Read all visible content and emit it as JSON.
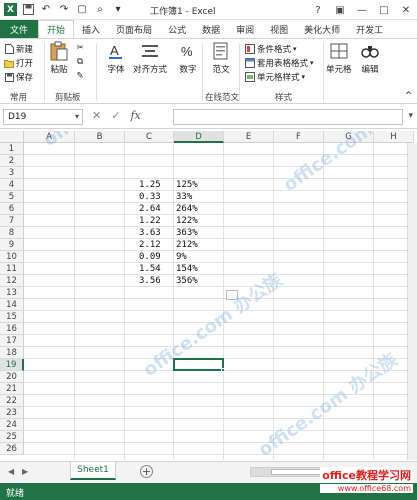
{
  "window": {
    "title": "工作簿1 - Excel",
    "minimize": "—",
    "restore": "□",
    "close": "✕",
    "help": "?",
    "ribbon_display": "▣"
  },
  "tabs": [
    {
      "label": "文件"
    },
    {
      "label": "开始"
    },
    {
      "label": "插入"
    },
    {
      "label": "页面布局"
    },
    {
      "label": "公式"
    },
    {
      "label": "数据"
    },
    {
      "label": "审阅"
    },
    {
      "label": "视图"
    },
    {
      "label": "美化大师"
    },
    {
      "label": "开发工"
    }
  ],
  "ribbon": {
    "quick_new": "新建",
    "quick_open": "打开",
    "quick_save": "保存",
    "group_common": "常用",
    "paste": "粘贴",
    "group_clipboard": "剪贴板",
    "font": "字体",
    "alignment": "对齐方式",
    "number": "数字",
    "fanwen": "范文",
    "group_fanwen": "在线范文",
    "conditional_format": "条件格式",
    "table_format": "套用表格格式",
    "cell_style": "单元格样式",
    "group_style": "样式",
    "cells": "单元格",
    "editing": "编辑"
  },
  "formula_bar": {
    "name_box": "D19",
    "cancel": "✕",
    "enter": "✓",
    "fx": "fx",
    "value": ""
  },
  "grid": {
    "columns": [
      "A",
      "B",
      "C",
      "D",
      "E",
      "F",
      "G",
      "H"
    ],
    "rows": [
      "1",
      "2",
      "3",
      "4",
      "5",
      "6",
      "7",
      "8",
      "9",
      "10",
      "11",
      "12",
      "13",
      "14",
      "15",
      "16",
      "17",
      "18",
      "19",
      "20",
      "21",
      "22",
      "23",
      "24",
      "25",
      "26"
    ],
    "selected_cell": "D19",
    "data_rows": [
      {
        "row": "4",
        "c": "1.25",
        "d": "125%"
      },
      {
        "row": "5",
        "c": "0.33",
        "d": "33%"
      },
      {
        "row": "6",
        "c": "2.64",
        "d": "264%"
      },
      {
        "row": "7",
        "c": "1.22",
        "d": "122%"
      },
      {
        "row": "8",
        "c": "3.63",
        "d": "363%"
      },
      {
        "row": "9",
        "c": "2.12",
        "d": "212%"
      },
      {
        "row": "10",
        "c": "0.09",
        "d": "9%"
      },
      {
        "row": "11",
        "c": "1.54",
        "d": "154%"
      },
      {
        "row": "12",
        "c": "3.56",
        "d": "356%"
      }
    ]
  },
  "sheets": {
    "active": "Sheet1",
    "add": "+"
  },
  "status": {
    "ready": "就绪"
  },
  "branding": {
    "line1": "office教程学习网",
    "line2": "www.office68.com"
  },
  "watermark": "office.com 办公族",
  "colors": {
    "accent": "#217346",
    "brand_red": "#e02020"
  }
}
